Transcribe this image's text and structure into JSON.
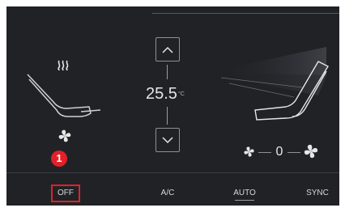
{
  "climate": {
    "temperature": "25.5",
    "temperature_unit": "°C",
    "fan_speed": "0"
  },
  "bottom_bar": {
    "off_label": "OFF",
    "ac_label": "A/C",
    "auto_label": "AUTO",
    "sync_label": "SYNC"
  },
  "annotation": {
    "step_number": "1"
  },
  "colors": {
    "panel_background": "#202226",
    "text": "#e6e6e6",
    "highlight": "#e2202a"
  },
  "icons": [
    "seat-heat-icon",
    "seat-icon",
    "fan-icon",
    "chevron-up-icon",
    "chevron-down-icon"
  ]
}
